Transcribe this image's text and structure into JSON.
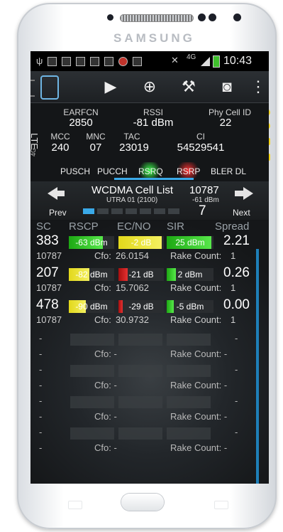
{
  "device": {
    "brand": "SAMSUNG"
  },
  "status_bar": {
    "time": "10:43",
    "network": "4G"
  },
  "toolbar": {
    "icons": [
      "app-logo-icon",
      "play-icon",
      "add-circle-icon",
      "wrench-icon",
      "camera-icon",
      "overflow-menu-icon"
    ]
  },
  "lte": {
    "tech_label": "LTE",
    "band_label": "4G",
    "earfcn": {
      "label": "EARFCN",
      "value": "2850"
    },
    "rssi": {
      "label": "RSSI",
      "value": "-81 dBm"
    },
    "pci": {
      "label": "Phy Cell ID",
      "value": "22"
    },
    "mcc": {
      "label": "MCC",
      "value": "240"
    },
    "mnc": {
      "label": "MNC",
      "value": "07"
    },
    "tac": {
      "label": "TAC",
      "value": "23019"
    },
    "ci": {
      "label": "CI",
      "value": "54529541"
    }
  },
  "tabs": [
    "PUSCH",
    "PUCCH",
    "RSRQ",
    "RSRP",
    "BLER DL"
  ],
  "cell_list": {
    "title": "WCDMA Cell List",
    "band": "UTRA 01 (2100)",
    "uarfcn": "10787",
    "level": "-61 dBm",
    "count": "7",
    "prev_label": "Prev",
    "next_label": "Next",
    "page_index": 0,
    "page_count": 7
  },
  "columns": [
    "SC",
    "RSCP",
    "EC/NO",
    "SIR",
    "Spread"
  ],
  "rows": [
    {
      "sc": "383",
      "rscp": "-63 dBm",
      "rscp_fill": 0.75,
      "rscp_color": "#2ec11f",
      "ecno": "-2 dB",
      "ecno_fill": 0.95,
      "ecno_color": "#e3d81b",
      "sir": "25 dBm",
      "sir_fill": 0.95,
      "sir_color": "#2ec11f",
      "spread": "2.21",
      "uarfcn": "10787",
      "cfo_label": "Cfo:",
      "cfo": "26.0154",
      "rake_label": "Rake Count:",
      "rake": "1"
    },
    {
      "sc": "207",
      "rscp": "-82 dBm",
      "rscp_fill": 0.45,
      "rscp_color": "#e3d81b",
      "ecno": "-21 dB",
      "ecno_fill": 0.2,
      "ecno_color": "#d01c1c",
      "sir": "2 dBm",
      "sir_fill": 0.2,
      "sir_color": "#2ec11f",
      "spread": "0.26",
      "uarfcn": "10787",
      "cfo_label": "Cfo:",
      "cfo": "15.7062",
      "rake_label": "Rake Count:",
      "rake": "1"
    },
    {
      "sc": "478",
      "rscp": "-90 dBm",
      "rscp_fill": 0.38,
      "rscp_color": "#e3d81b",
      "ecno": "-29 dB",
      "ecno_fill": 0.1,
      "ecno_color": "#d01c1c",
      "sir": "-5 dBm",
      "sir_fill": 0.15,
      "sir_color": "#2ec11f",
      "spread": "0.00",
      "uarfcn": "10787",
      "cfo_label": "Cfo:",
      "cfo": "30.9732",
      "rake_label": "Rake Count:",
      "rake": "1"
    }
  ],
  "empty_rows": [
    {
      "sc": "-",
      "spread": "-",
      "uarfcn": "-",
      "cfo": "Cfo: -",
      "rake": "Rake Count: -"
    },
    {
      "sc": "-",
      "spread": "-",
      "uarfcn": "-",
      "cfo": "Cfo: -",
      "rake": "Rake Count: -"
    },
    {
      "sc": "-",
      "spread": "-",
      "uarfcn": "-",
      "cfo": "Cfo: -",
      "rake": "Rake Count: -"
    },
    {
      "sc": "-",
      "spread": "-",
      "uarfcn": "-",
      "cfo": "Cfo: -",
      "rake": "Rake Count: -"
    }
  ]
}
